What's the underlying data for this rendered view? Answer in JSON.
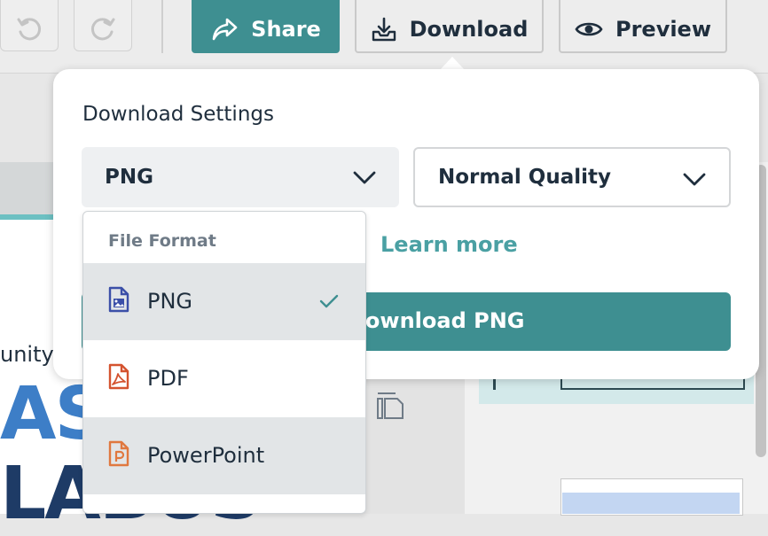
{
  "toolbar": {
    "share_label": "Share",
    "download_label": "Download",
    "preview_label": "Preview"
  },
  "background": {
    "text_fragment": "unity",
    "big_text_1": "ASS",
    "big_text_2": "LABUS"
  },
  "download_settings": {
    "title": "Download Settings",
    "format_selected": "PNG",
    "quality_selected": "Normal Quality",
    "learn_more": "Learn more",
    "download_button": "Download PNG"
  },
  "format_menu": {
    "header": "File Format",
    "items": [
      {
        "label": "PNG",
        "icon": "png-file-icon",
        "selected": true
      },
      {
        "label": "PDF",
        "icon": "pdf-file-icon",
        "selected": false
      },
      {
        "label": "PowerPoint",
        "icon": "powerpoint-file-icon",
        "selected": false
      }
    ]
  },
  "colors": {
    "accent": "#3e8f91",
    "link": "#4aa0a3",
    "png_icon": "#3b4fa8",
    "pdf_icon": "#d4532f",
    "ppt_icon": "#e0783f"
  }
}
